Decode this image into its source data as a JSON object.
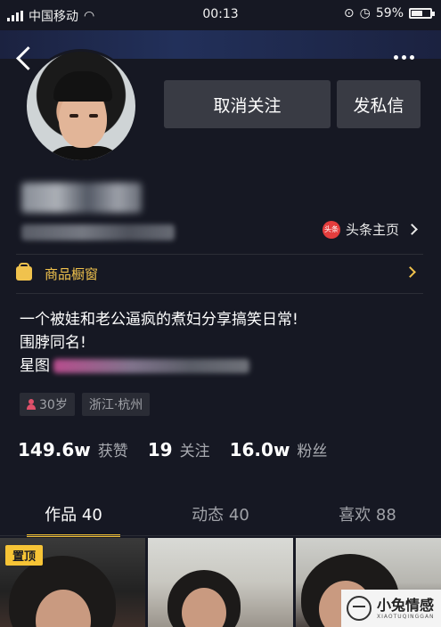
{
  "status_bar": {
    "carrier": "中国移动",
    "time": "00:13",
    "battery": "59%",
    "battery_level": 0.59,
    "icons": [
      "signal-icon",
      "wifi-icon",
      "rotation-lock-icon",
      "alarm-icon",
      "battery-icon"
    ]
  },
  "header": {
    "back_icon": "chevron-left-icon",
    "more_icon": "more-dots-icon",
    "unfollow_label": "取消关注",
    "message_label": "发私信"
  },
  "profile": {
    "name": "",
    "id": "",
    "toutiao_logo": "头条",
    "toutiao_label": "头条主页"
  },
  "shop": {
    "label": "商品橱窗"
  },
  "bio": {
    "line1": "一个被娃和老公逼疯的煮妇分享搞笑日常!",
    "line2": "围脖同名!",
    "line3_prefix": "星图"
  },
  "tags": {
    "age": "30岁",
    "location": "浙江·杭州"
  },
  "stats": {
    "likes_num": "149.6w",
    "likes_label": "获赞",
    "following_num": "19",
    "following_label": "关注",
    "followers_num": "16.0w",
    "followers_label": "粉丝"
  },
  "tabs": {
    "works": "作品 40",
    "activity": "动态 40",
    "likes": "喜欢 88",
    "active": "works"
  },
  "grid": {
    "pinned_label": "置顶"
  },
  "watermark": {
    "cn": "小兔情感",
    "en": "XIAOTUQINGGAN"
  },
  "colors": {
    "background": "#161823",
    "accent": "#f7c436",
    "button": "#393b44",
    "shop_text": "#f0c24d"
  }
}
